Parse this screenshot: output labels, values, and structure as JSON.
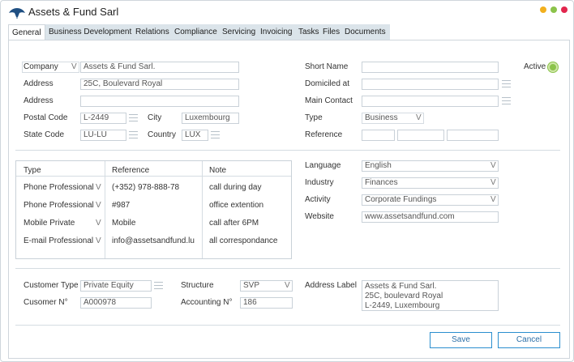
{
  "window": {
    "title": "Assets & Fund Sarl",
    "controls": {
      "minimize_color": "#f2b01e",
      "maximize_color": "#8bc34a",
      "close_color": "#e2264d"
    }
  },
  "tabs": [
    "General",
    "Business Development",
    "Relations",
    "Compliance",
    "Servicing",
    "Invoicing",
    "Tasks",
    "Files",
    "Documents"
  ],
  "company": {
    "company_label": "Company",
    "company_type": "V",
    "company_value": "Assets & Fund Sarl.",
    "address1_label": "Address",
    "address1_value": "25C, Boulevard Royal",
    "address2_label": "Address",
    "address2_value": "",
    "postal_label": "Postal Code",
    "postal_value": "L-2449",
    "city_label": "City",
    "city_value": "Luxembourg",
    "state_label": "State Code",
    "state_value": "LU-LU",
    "country_label": "Country",
    "country_value": "LUX"
  },
  "right_top": {
    "short_name_label": "Short Name",
    "short_name_value": "",
    "domiciled_label": "Domiciled at",
    "domiciled_value": "",
    "main_contact_label": "Main Contact",
    "main_contact_value": "",
    "type_label": "Type",
    "type_value": "Business",
    "type_chev": "V",
    "reference_label": "Reference",
    "active_label": "Active"
  },
  "contacts": {
    "headers": [
      "Type",
      "Reference",
      "Note"
    ],
    "rows": [
      {
        "type": "Phone Professional",
        "chev": "V",
        "reference": "(+352) 978-888-78",
        "note": "call during day"
      },
      {
        "type": "Phone Professional",
        "chev": "V",
        "reference": "#987",
        "note": "office extention"
      },
      {
        "type": "Mobile Private",
        "chev": "V",
        "reference": "Mobile",
        "note": "call after 6PM"
      },
      {
        "type": "E-mail Professional",
        "chev": "V",
        "reference": "info@assetsandfund.lu",
        "note": "all correspondance"
      }
    ]
  },
  "right_mid": {
    "language_label": "Language",
    "language_value": "English",
    "industry_label": "Industry",
    "industry_value": "Finances",
    "activity_label": "Activity",
    "activity_value": "Corporate Fundings",
    "website_label": "Website",
    "website_value": "www.assetsandfund.com",
    "chev": "V"
  },
  "bottom": {
    "customer_type_label": "Customer Type",
    "customer_type_value": "Private Equity",
    "customer_no_label": "Cusomer N°",
    "customer_no_value": "A000978",
    "structure_label": "Structure",
    "structure_value": "SVP",
    "structure_chev": "V",
    "accounting_label": "Accounting N°",
    "accounting_value": "186",
    "address_label_label": "Address Label",
    "address_label_value": "Assets & Fund Sarl.\n25C, boulevard Royal\nL-2449, Luxembourg"
  },
  "buttons": {
    "save": "Save",
    "cancel": "Cancel"
  }
}
